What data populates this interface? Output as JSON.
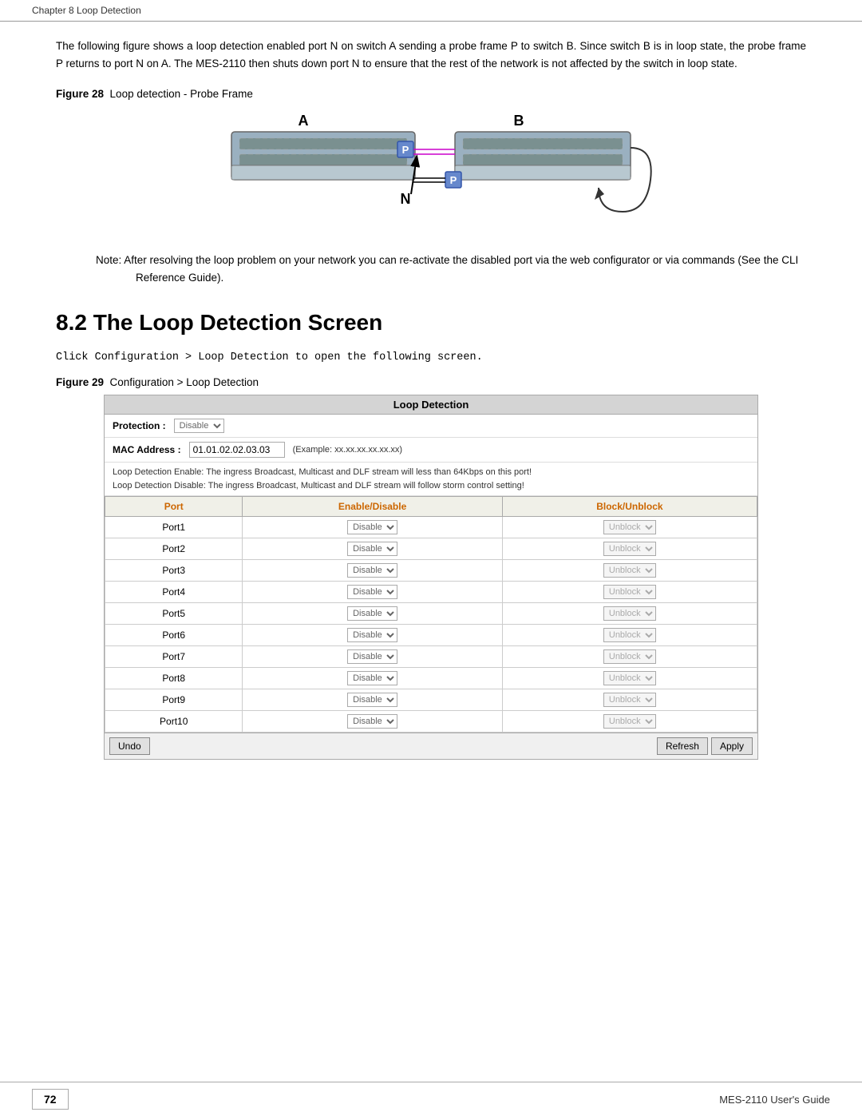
{
  "breadcrumb": "Chapter 8 Loop Detection",
  "intro_paragraph": "The following figure shows a loop detection enabled port N on switch A sending a probe frame P to switch B. Since switch B is in loop state, the probe frame P returns to port N on A. The MES-2110 then shuts down port N to ensure that the rest of the network is not affected by the switch in loop state.",
  "figure28_label": "Figure 28",
  "figure28_caption": "Loop detection - Probe Frame",
  "note_text": "Note: After resolving the loop problem on your network you can re-activate the disabled port via the web configurator or via commands (See the CLI Reference Guide).",
  "section_heading": "8.2  The Loop Detection Screen",
  "click_instruction": "Click Configuration > Loop Detection to open the following screen.",
  "figure29_label": "Figure 29",
  "figure29_caption": "Configuration > Loop Detection",
  "loop_detection": {
    "title": "Loop Detection",
    "protection_label": "Protection :",
    "protection_value": "Disable",
    "mac_label": "MAC Address :",
    "mac_value": "01.01.02.02.03.03",
    "mac_example": "(Example: xx.xx.xx.xx.xx.xx)",
    "info1": "Loop Detection Enable: The ingress Broadcast, Multicast and DLF stream will less than 64Kbps on this port!",
    "info2": "Loop Detection Disable: The ingress Broadcast, Multicast and DLF stream will follow storm control setting!",
    "col_port": "Port",
    "col_enable": "Enable/Disable",
    "col_block": "Block/Unblock",
    "ports": [
      {
        "name": "Port1"
      },
      {
        "name": "Port2"
      },
      {
        "name": "Port3"
      },
      {
        "name": "Port4"
      },
      {
        "name": "Port5"
      },
      {
        "name": "Port6"
      },
      {
        "name": "Port7"
      },
      {
        "name": "Port8"
      },
      {
        "name": "Port9"
      },
      {
        "name": "Port10"
      }
    ],
    "enable_option": "Disable",
    "block_option": "Unblock",
    "btn_undo": "Undo",
    "btn_refresh": "Refresh",
    "btn_apply": "Apply"
  },
  "footer": {
    "page_number": "72",
    "guide_text": "MES-2110 User's Guide"
  }
}
